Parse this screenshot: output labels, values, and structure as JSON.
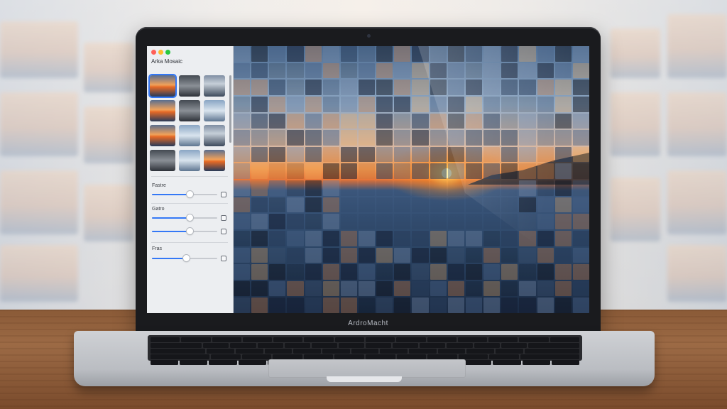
{
  "laptop": {
    "brand_label": "ArdroMacht"
  },
  "app": {
    "panel_title": "Arka Mosaic",
    "sections": [
      {
        "label": "Fastre",
        "value": 0.58
      },
      {
        "label": "Gatro",
        "value": 0.58
      },
      {
        "label": "",
        "value": 0.58
      },
      {
        "label": "Fras",
        "value": 0.52
      }
    ],
    "selected_thumbnail_index": 0,
    "thumbnail_count": 12
  },
  "colors": {
    "accent": "#3478f6",
    "traffic_red": "#ff5f57",
    "traffic_yellow": "#febc2e",
    "traffic_green": "#28c840"
  },
  "icons": [
    "close-icon",
    "minimize-icon",
    "zoom-icon",
    "slider-end-icon"
  ]
}
